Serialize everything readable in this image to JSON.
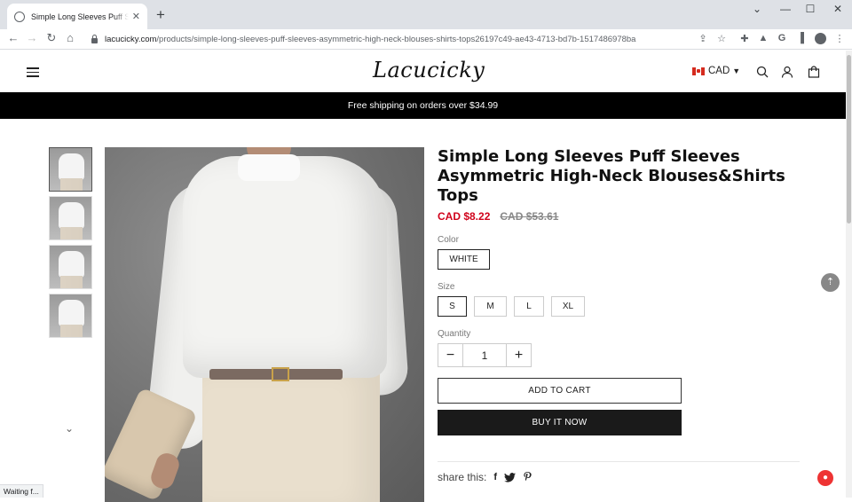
{
  "browser": {
    "tab_title": "Simple Long Sleeves Puff Sleeves",
    "new_tab_label": "+",
    "url_host": "lacucicky.com",
    "url_path": "/products/simple-long-sleeves-puff-sleeves-asymmetric-high-neck-blouses-shirts-tops26197c49-ae43-4713-bd7b-1517486978ba",
    "status_text": "Waiting f..."
  },
  "site": {
    "logo": "Lacucicky",
    "currency": "CAD",
    "banner": "Free shipping on orders over $34.99"
  },
  "product": {
    "title": "Simple Long Sleeves Puff Sleeves Asymmetric High-Neck Blouses&Shirts Tops",
    "price_sale": "CAD $8.22",
    "price_original": "CAD $53.61",
    "color_label": "Color",
    "colors": [
      "WHITE"
    ],
    "selected_color": "WHITE",
    "size_label": "Size",
    "sizes": [
      "S",
      "M",
      "L",
      "XL"
    ],
    "selected_size": "S",
    "quantity_label": "Quantity",
    "quantity": "1",
    "add_to_cart": "ADD TO CART",
    "buy_now": "BUY IT NOW",
    "share_label": "share this:"
  },
  "icons": {
    "facebook": "f",
    "twitter": "🐦",
    "pinterest": "P"
  },
  "colors": {
    "sale_price": "#d0021b",
    "banner_bg": "#000000",
    "buy_now_bg": "#1a1a1a"
  }
}
